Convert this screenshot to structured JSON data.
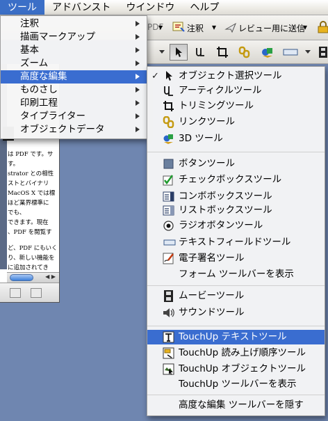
{
  "menubar": {
    "items": [
      "ツール",
      "アドバンスト",
      "ウインドウ",
      "ヘルプ"
    ],
    "active_index": 0
  },
  "toolbar": {
    "annotate_label": "注釈",
    "send_review_label": "レビュー用に送信",
    "pdf_fragment": "PDF"
  },
  "tools_menu": {
    "items": [
      "注釈",
      "描画マークアップ",
      "基本",
      "ズーム",
      "高度な編集",
      "ものさし",
      "印刷工程",
      "タイプライター",
      "オブジェクトデータ"
    ],
    "highlighted_index": 4
  },
  "advanced_editing_menu": {
    "groups": [
      [
        {
          "label": "オブジェクト選択ツール",
          "icon": "arrow-select-icon",
          "checked": true
        },
        {
          "label": "アーティクルツール",
          "icon": "article-icon"
        },
        {
          "label": "トリミングツール",
          "icon": "crop-icon"
        },
        {
          "label": "リンクツール",
          "icon": "link-icon"
        },
        {
          "label": "3D ツール",
          "icon": "3d-icon"
        }
      ],
      [
        {
          "label": "ボタンツール",
          "icon": "button-icon"
        },
        {
          "label": "チェックボックスツール",
          "icon": "checkbox-icon"
        },
        {
          "label": "コンボボックスツール",
          "icon": "combobox-icon"
        },
        {
          "label": "リストボックスツール",
          "icon": "listbox-icon"
        },
        {
          "label": "ラジオボタンツール",
          "icon": "radio-icon"
        },
        {
          "label": "テキストフィールドツール",
          "icon": "textfield-icon"
        },
        {
          "label": "電子署名ツール",
          "icon": "signature-icon"
        },
        {
          "label": "フォーム ツールバーを表示",
          "icon": ""
        }
      ],
      [
        {
          "label": "ムービーツール",
          "icon": "movie-icon"
        },
        {
          "label": "サウンドツール",
          "icon": "sound-icon"
        }
      ],
      [
        {
          "label": "TouchUp テキストツール",
          "icon": "touchup-text-icon",
          "highlighted": true
        },
        {
          "label": "TouchUp 読み上げ順序ツール",
          "icon": "reading-order-icon"
        },
        {
          "label": "TouchUp オブジェクトツール",
          "icon": "touchup-object-icon"
        },
        {
          "label": "TouchUp  ツールバーを表示",
          "icon": ""
        }
      ],
      [
        {
          "label": "高度な編集 ツールバーを隠す",
          "icon": ""
        }
      ]
    ]
  },
  "document_text": {
    "lines": [
      "は PDF です。サ",
      "す。",
      "strator との相性",
      "ストとバイナリ",
      "MacOS X では標",
      "ほど業界標準に",
      "でも、",
      "できます。現在",
      "、PDF を閲覧す",
      "",
      "ど、PDF にもいく",
      "り、新しい機能を",
      "に追加されてき"
    ]
  },
  "colors": {
    "highlight": "#3a6dd0",
    "desktop": "#6f86b0"
  }
}
